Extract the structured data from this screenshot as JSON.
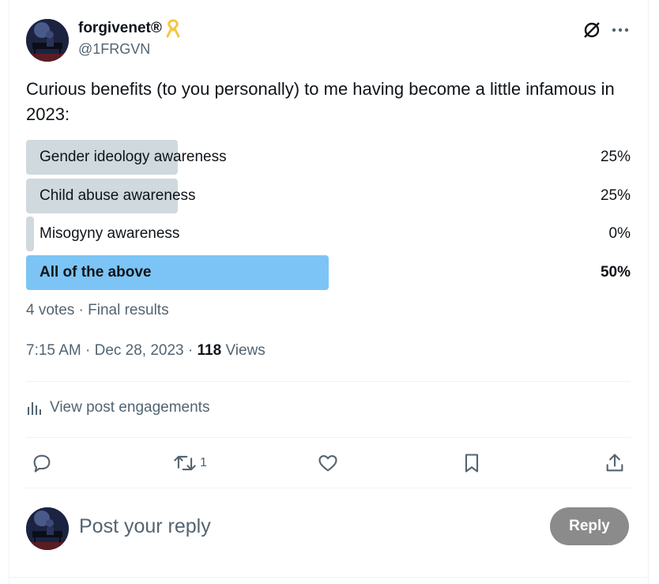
{
  "author": {
    "display_name": "forgivenet®",
    "handle": "@1FRGVN",
    "avatar_icon": "pianist-avatar-icon",
    "badge_icon": "yellow-ribbon-icon"
  },
  "tweet": {
    "text": "Curious benefits (to you personally) to me having become a little infamous in 2023:"
  },
  "poll": {
    "options": [
      {
        "label": "Gender ideology awareness",
        "percent_label": "25%",
        "percent": 25,
        "winner": false
      },
      {
        "label": "Child abuse awareness",
        "percent_label": "25%",
        "percent": 25,
        "winner": false
      },
      {
        "label": "Misogyny awareness",
        "percent_label": "0%",
        "percent": 0,
        "winner": false
      },
      {
        "label": "All of the above",
        "percent_label": "50%",
        "percent": 50,
        "winner": true
      }
    ],
    "meta": "4 votes · Final results"
  },
  "timestamp": {
    "time": "7:15 AM · Dec 28, 2023 · ",
    "views_count": "118",
    "views_label": " Views"
  },
  "engagements": {
    "label": "View post engagements",
    "icon": "bar-chart-icon"
  },
  "actions": {
    "reply_icon": "speech-bubble-icon",
    "retweet_icon": "retweet-icon",
    "retweet_count": "1",
    "like_icon": "heart-icon",
    "bookmark_icon": "bookmark-icon",
    "share_icon": "share-upload-icon"
  },
  "reply": {
    "placeholder": "Post your reply",
    "button_label": "Reply"
  },
  "colors": {
    "poll_fill": "#cfd9de",
    "poll_winner_fill": "#7cc4f5",
    "secondary_text": "#536471",
    "reply_button": "#8b8b8b"
  }
}
